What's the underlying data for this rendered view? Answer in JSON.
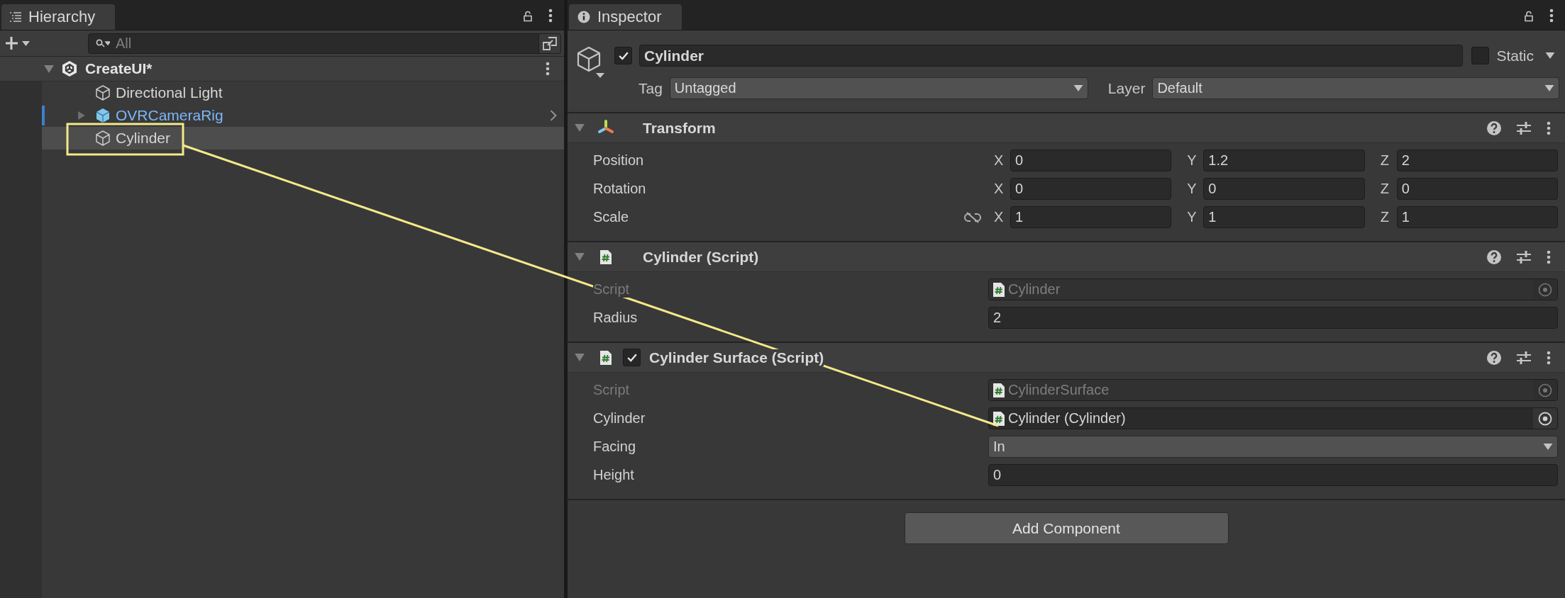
{
  "hierarchy": {
    "title": "Hierarchy",
    "search": {
      "placeholder": "All"
    },
    "scene": {
      "name": "CreateUI*",
      "expanded": true,
      "children": [
        {
          "name": "Directional Light",
          "kind": "object",
          "selected": false
        },
        {
          "name": "OVRCameraRig",
          "kind": "prefab",
          "selected": false,
          "expanded": false
        },
        {
          "name": "Cylinder",
          "kind": "object",
          "selected": true
        }
      ]
    }
  },
  "inspector": {
    "title": "Inspector",
    "object": {
      "active": true,
      "name": "Cylinder",
      "static": false,
      "static_label": "Static",
      "tag_label": "Tag",
      "tag": "Untagged",
      "layer_label": "Layer",
      "layer": "Default"
    },
    "components": [
      {
        "kind": "transform",
        "title": "Transform",
        "expanded": true,
        "rows": [
          {
            "kind": "vector",
            "label": "Position",
            "fields": [
              {
                "axis": "X",
                "value": "0"
              },
              {
                "axis": "Y",
                "value": "1.2"
              },
              {
                "axis": "Z",
                "value": "2"
              }
            ]
          },
          {
            "kind": "vector",
            "label": "Rotation",
            "fields": [
              {
                "axis": "X",
                "value": "0"
              },
              {
                "axis": "Y",
                "value": "0"
              },
              {
                "axis": "Z",
                "value": "0"
              }
            ]
          },
          {
            "kind": "vector",
            "label": "Scale",
            "proportional": false,
            "fields": [
              {
                "axis": "X",
                "value": "1"
              },
              {
                "axis": "Y",
                "value": "1"
              },
              {
                "axis": "Z",
                "value": "1"
              }
            ]
          }
        ]
      },
      {
        "kind": "script",
        "title": "Cylinder (Script)",
        "expanded": true,
        "rows": [
          {
            "kind": "script",
            "label": "Script",
            "value": "Cylinder",
            "disabled": true
          },
          {
            "kind": "number",
            "label": "Radius",
            "value": "2"
          }
        ]
      },
      {
        "kind": "script",
        "title": "Cylinder Surface (Script)",
        "expanded": true,
        "enabled": true,
        "rows": [
          {
            "kind": "script",
            "label": "Script",
            "value": "CylinderSurface",
            "disabled": true
          },
          {
            "kind": "object",
            "label": "Cylinder",
            "value": "Cylinder (Cylinder)"
          },
          {
            "kind": "dropdown",
            "label": "Facing",
            "value": "In"
          },
          {
            "kind": "number",
            "label": "Height",
            "value": "0"
          }
        ]
      }
    ],
    "add_button": "Add Component"
  }
}
